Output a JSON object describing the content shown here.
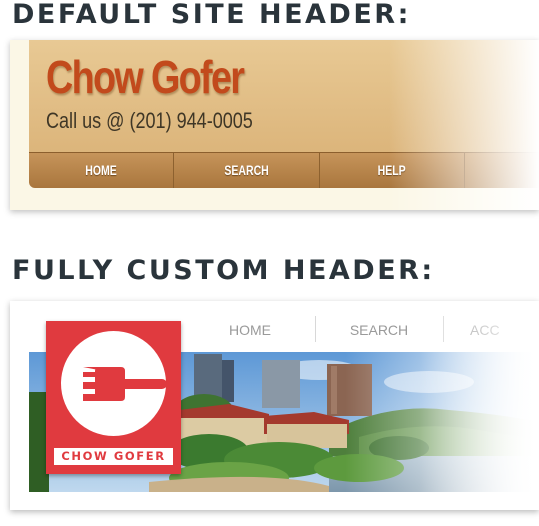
{
  "sections": {
    "default_title": "DEFAULT SITE HEADER:",
    "custom_title": "FULLY CUSTOM HEADER:"
  },
  "default_header": {
    "brand": "Chow Gofer",
    "phone": "Call us @ (201) 944-0005",
    "nav": [
      "HOME",
      "SEARCH",
      "HELP"
    ]
  },
  "custom_header": {
    "nav": [
      "HOME",
      "SEARCH",
      "ACC"
    ],
    "logo_text": "CHOW GOFER",
    "logo_icon": "fork-icon",
    "photo_icon": "city-waterfront-photo"
  },
  "colors": {
    "title_text": "#2a343b",
    "brand_red": "#c24a1c",
    "banner_tan": "#e8c994",
    "nav_brown": "#b07d43",
    "logo_red": "#e03a3f"
  }
}
